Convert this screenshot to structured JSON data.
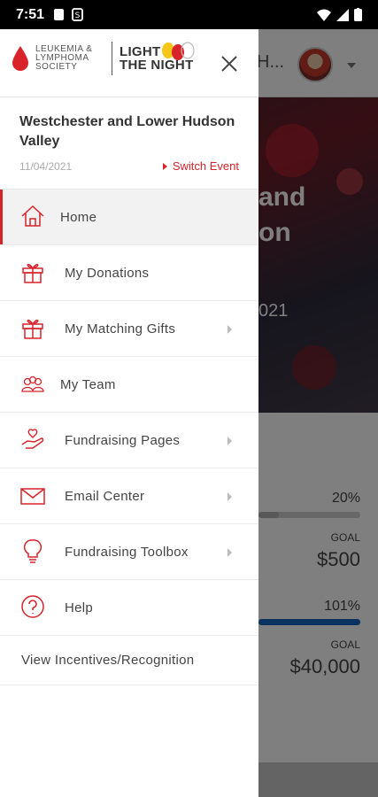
{
  "status_bar": {
    "time": "7:51"
  },
  "background": {
    "title_fragment": "H...",
    "hero_lines": [
      "and",
      "on"
    ],
    "hero_date": "021",
    "stat1": {
      "percent": "20%",
      "goal_label": "GOAL",
      "goal_value": "$500",
      "progress": 0.2
    },
    "stat2": {
      "percent": "101%",
      "goal_label": "GOAL",
      "goal_value": "$40,000",
      "progress": 1.0
    },
    "colors": {
      "progress_fill": "#1565c0",
      "brand_red": "#d8232a"
    }
  },
  "drawer": {
    "logo": {
      "lls_lines": [
        "LEUKEMIA &",
        "LYMPHOMA",
        "SOCIETY"
      ],
      "ltn_lines": [
        "LIGHT",
        "THE NIGHT"
      ]
    },
    "event": {
      "name": "Westchester and Lower Hudson Valley",
      "date": "11/04/2021",
      "switch_label": "Switch Event"
    },
    "menu": [
      {
        "label": "Home",
        "icon": "home-icon"
      },
      {
        "label": "My Donations",
        "icon": "gift-icon"
      },
      {
        "label": "My Matching Gifts",
        "icon": "gift-icon"
      },
      {
        "label": "My Team",
        "icon": "team-icon"
      },
      {
        "label": "Fundraising Pages",
        "icon": "hand-heart-icon"
      },
      {
        "label": "Email Center",
        "icon": "envelope-icon"
      },
      {
        "label": "Fundraising Toolbox",
        "icon": "lightbulb-icon"
      },
      {
        "label": "Help",
        "icon": "help-icon"
      },
      {
        "label": "View Incentives/Recognition"
      }
    ]
  }
}
